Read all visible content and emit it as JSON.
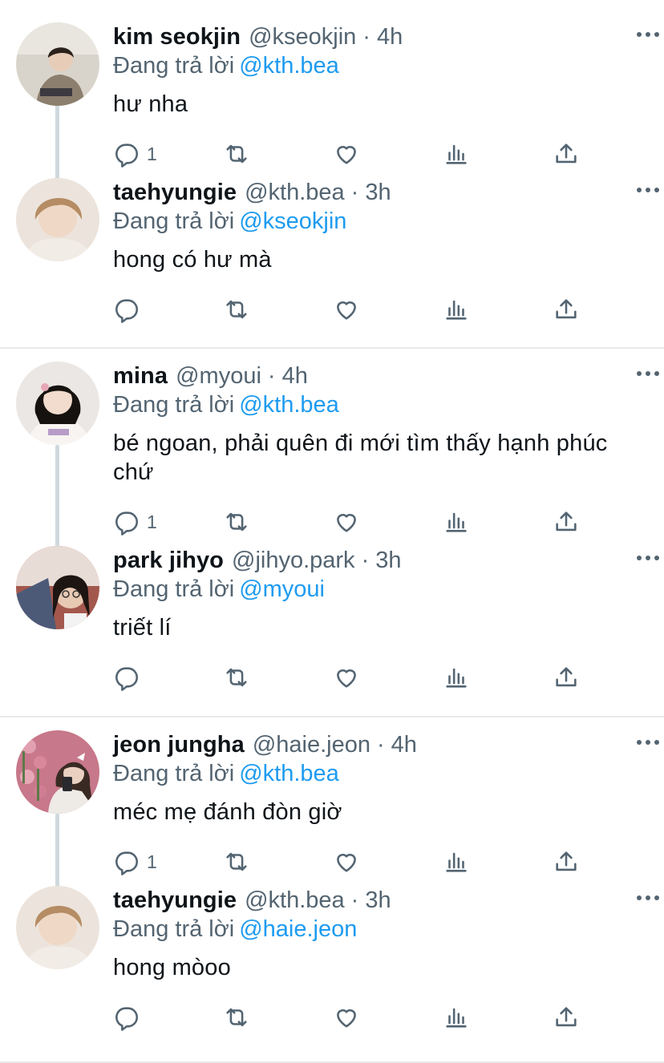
{
  "reply_prefix": "Đang trả lời",
  "blocks": [
    {
      "tweets": [
        {
          "name": "kim seokjin",
          "handle": "@kseokjin",
          "time": "4h",
          "reply_to": "@kth.bea",
          "text": "hư nha",
          "reply_count": "1",
          "avatar_colors": {
            "bg": "#d9d4cb",
            "skin": "#e7cdb8",
            "hair": "#2b211c",
            "shirt": "#8c7f6e"
          }
        },
        {
          "name": "taehyungie",
          "handle": "@kth.bea",
          "time": "3h",
          "reply_to": "@kseokjin",
          "text": "hong có hư mà",
          "reply_count": "",
          "avatar_colors": {
            "bg": "#ece4dc",
            "skin": "#efd8c6",
            "hair": "#b58c63",
            "shirt": "#f2ece6"
          }
        }
      ]
    },
    {
      "tweets": [
        {
          "name": "mina",
          "handle": "@myoui",
          "time": "4h",
          "reply_to": "@kth.bea",
          "text": "bé ngoan, phải quên đi mới tìm thấy hạnh phúc chứ",
          "reply_count": "1",
          "avatar_colors": {
            "bg": "#ebe7e4",
            "skin": "#f2dccd",
            "hair": "#16120f",
            "shirt": "#f7f4f2"
          }
        },
        {
          "name": "park jihyo",
          "handle": "@jihyo.park",
          "time": "3h",
          "reply_to": "@myoui",
          "text": "triết lí",
          "reply_count": "",
          "avatar_colors": {
            "bg": "#a3584d",
            "skin": "#e8c9b3",
            "hair": "#1d1512",
            "shirt": "#4c5a78"
          }
        }
      ]
    },
    {
      "tweets": [
        {
          "name": "jeon jungha",
          "handle": "@haie.jeon",
          "time": "4h",
          "reply_to": "@kth.bea",
          "text": "méc mẹ đánh đòn giờ",
          "reply_count": "1",
          "avatar_colors": {
            "bg": "#c7788a",
            "skin": "#e9d0c0",
            "hair": "#3a2a24",
            "shirt": "#eeeae6"
          }
        },
        {
          "name": "taehyungie",
          "handle": "@kth.bea",
          "time": "3h",
          "reply_to": "@haie.jeon",
          "text": "hong mòoo",
          "reply_count": "",
          "avatar_colors": {
            "bg": "#ece4dc",
            "skin": "#efd8c6",
            "hair": "#b58c63",
            "shirt": "#f2ece6"
          }
        }
      ]
    }
  ],
  "icons": [
    "reply-icon",
    "retweet-icon",
    "like-icon",
    "views-icon",
    "share-icon",
    "more-icon"
  ],
  "colors": {
    "text": "#0f1419",
    "muted": "#536471",
    "link": "#1d9bf0",
    "divider": "#e7e9eb",
    "thread_line": "#cfd9de"
  }
}
